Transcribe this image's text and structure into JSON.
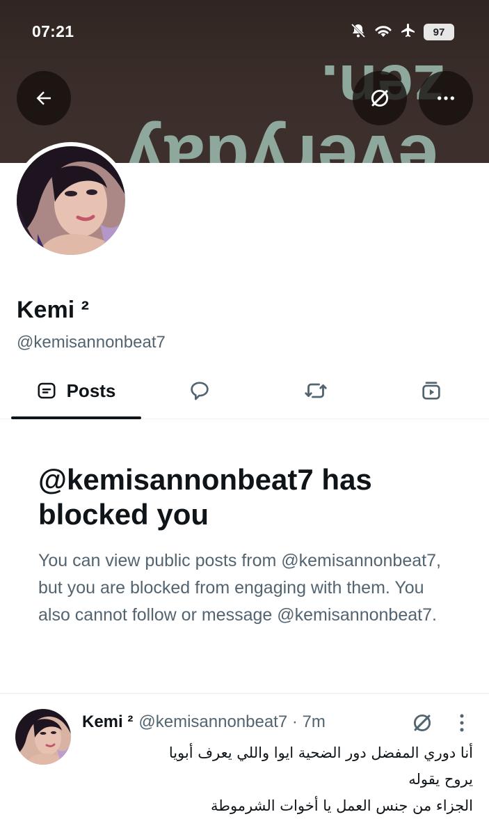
{
  "status_bar": {
    "time": "07:21",
    "battery": "97",
    "icons": [
      "bell-slash-icon",
      "wifi-icon",
      "airplane-icon",
      "battery-icon"
    ]
  },
  "banner": {
    "art_text_top": "zen.",
    "art_text_bottom": "everyday",
    "colors": {
      "background": "#3d302c",
      "lettering": "#8fa89d"
    }
  },
  "header_buttons": {
    "back": "back-arrow-icon",
    "grok": "grok-icon",
    "more": "more-horizontal-icon"
  },
  "profile": {
    "display_name": "Kemi",
    "name_suffix": "²",
    "handle": "@kemisannonbeat7"
  },
  "tabs": [
    {
      "label": "Posts",
      "icon": "posts-icon",
      "active": true
    },
    {
      "label": "",
      "icon": "reply-bubble-icon",
      "active": false
    },
    {
      "label": "",
      "icon": "repost-icon",
      "active": false
    },
    {
      "label": "",
      "icon": "media-icon",
      "active": false
    }
  ],
  "blocked_notice": {
    "title": "@kemisannonbeat7 has blocked you",
    "description": "You can view public posts from @kemisannonbeat7, but you are blocked from engaging with them. You also cannot follow or message @kemisannonbeat7."
  },
  "tweet": {
    "name": "Kemi ²",
    "meta": "@kemisannonbeat7 · 7m",
    "lines": [
      "أنا دوري المفضل دور الضحية ايوا واللي يعرف أبويا",
      "يروح يقوله",
      "الجزاء من جنس العمل يا أخوات الشرموطة"
    ]
  },
  "colors": {
    "text_primary": "#0f1419",
    "text_secondary": "#536471",
    "divider": "#eff3f4"
  }
}
